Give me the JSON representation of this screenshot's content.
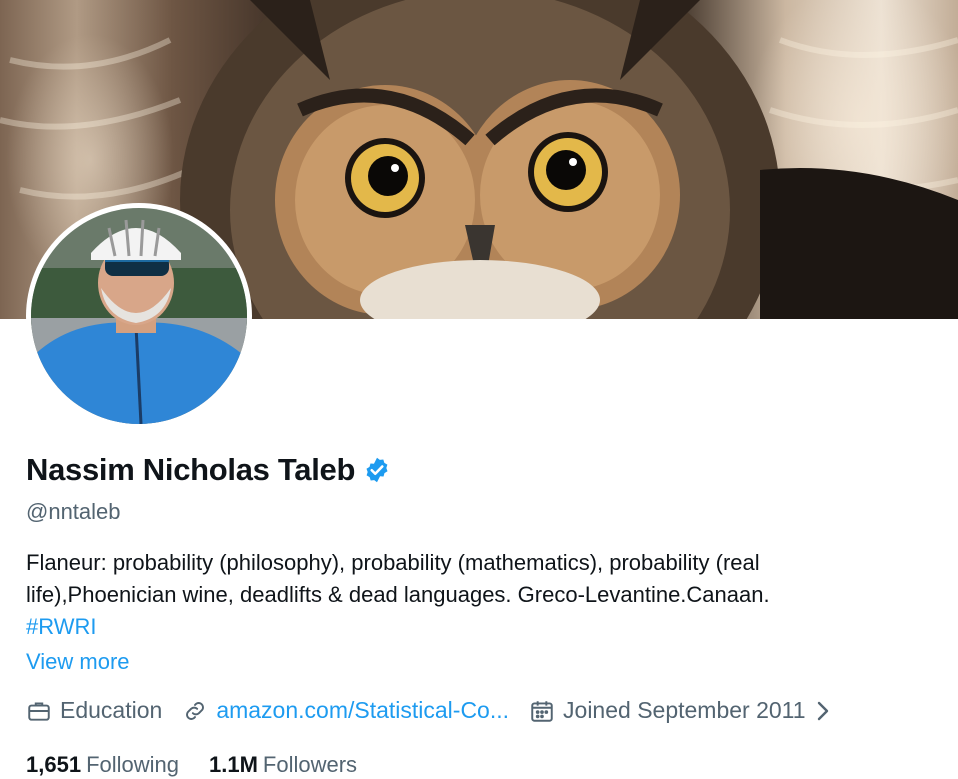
{
  "banner": {
    "icon": "owl-photo"
  },
  "avatar": {
    "icon": "profile-photo-cyclist"
  },
  "profile": {
    "name": "Nassim Nicholas Taleb",
    "verified": true,
    "handle": "@nntaleb",
    "bio_lines": [
      "Flaneur: probability (philosophy), probability (mathematics), probability (real",
      "life),Phoenician wine, deadlifts & dead languages. Greco-Levantine.Canaan."
    ],
    "hashtag": "#RWRI",
    "view_more": "View more"
  },
  "meta": {
    "category": "Education",
    "website": "amazon.com/Statistical-Co...",
    "joined": "Joined September 2011"
  },
  "stats": {
    "following_count": "1,651",
    "following_label": "Following",
    "followers_count": "1.1M",
    "followers_label": "Followers"
  },
  "colors": {
    "accent": "#1d9bf0",
    "secondary_text": "#536471",
    "primary_text": "#0f1419"
  }
}
